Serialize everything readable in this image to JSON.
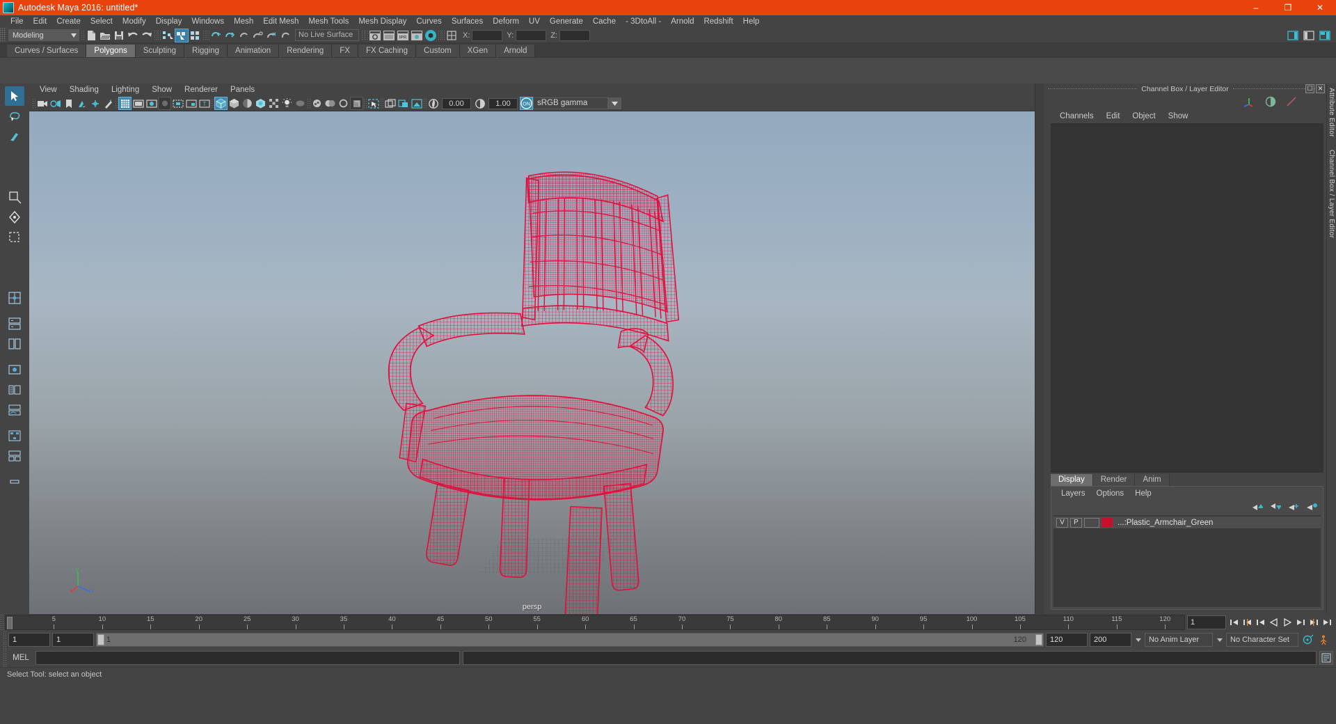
{
  "window": {
    "title": "Autodesk Maya 2016: untitled*",
    "logo_icon": "maya-logo-icon",
    "minimize": "–",
    "maximize": "❐",
    "close": "✕"
  },
  "menubar": {
    "items": [
      "File",
      "Edit",
      "Create",
      "Select",
      "Modify",
      "Display",
      "Windows",
      "Mesh",
      "Edit Mesh",
      "Mesh Tools",
      "Mesh Display",
      "Curves",
      "Surfaces",
      "Deform",
      "UV",
      "Generate",
      "Cache",
      "- 3DtoAll -",
      "Arnold",
      "Redshift",
      "Help"
    ]
  },
  "statusline": {
    "mode": "Modeling",
    "mode_arrow_icon": "chevron-down-icon",
    "live_surface": "No Live Surface",
    "coord_labels": [
      "X:",
      "Y:",
      "Z:"
    ],
    "coord_values": [
      "",
      "",
      ""
    ],
    "icons": [
      "new-scene-icon",
      "open-scene-icon",
      "save-scene-icon",
      "undo-icon",
      "redo-icon",
      "select-hierarchy-icon",
      "select-object-icon",
      "select-component-icon",
      "snap-grid-icon",
      "snap-curve-icon",
      "snap-point-icon",
      "snap-projected-icon",
      "snap-view-plane-icon",
      "render-current-frame-icon",
      "ipr-render-icon",
      "render-settings-icon",
      "hypershade-icon",
      "show-manipulator-icon"
    ],
    "right_icons": [
      "sidebar-attribute-editor-icon",
      "sidebar-tool-settings-icon",
      "sidebar-channel-box-icon"
    ]
  },
  "shelf": {
    "tabs": [
      "Curves / Surfaces",
      "Polygons",
      "Sculpting",
      "Rigging",
      "Animation",
      "Rendering",
      "FX",
      "FX Caching",
      "Custom",
      "XGen",
      "Arnold"
    ],
    "active_tab": "Polygons",
    "icons": [
      "poly-sphere-icon",
      "poly-cube-icon",
      "poly-cylinder-icon",
      "poly-cone-icon",
      "poly-plane-icon",
      "poly-torus-icon",
      "poly-pyramid-icon",
      "poly-prism-icon",
      "SEP",
      "combine-icon",
      "separate-icon",
      "mirror-geometry-icon",
      "smooth-icon",
      "boolean-icon",
      "extrude-icon",
      "create-poly-tool-icon",
      "multi-cut-icon",
      "bevel-icon",
      "bridge-icon",
      "append-polygon-icon",
      "connect-icon",
      "offset-edge-loop-icon",
      "merge-vertex-icon",
      "SEP",
      "uv-planar-icon",
      "uv-cylindrical-icon",
      "uv-spherical-icon",
      "uv-automatic-icon",
      "uv-unfold-icon",
      "uv-editor-icon",
      "uv-cut-icon"
    ],
    "accent_color": "#d88a46",
    "accent_color2": "#58ab86"
  },
  "toolbox": {
    "items": [
      "select-tool-icon",
      "lasso-select-tool-icon",
      "paint-select-tool-icon",
      "move-tool-icon",
      "rotate-tool-icon",
      "scale-tool-icon",
      "soft-select-tool-icon",
      "four-view-layout-icon",
      "two-pane-stacked-icon",
      "two-pane-side-icon",
      "single-perspective-icon",
      "outliner-persp-icon",
      "persp-graph-icon",
      "hypergraph-icon",
      "persp-outliner-icon",
      "last-tool-icon"
    ],
    "selected": "select-tool-icon"
  },
  "viewport": {
    "menu": [
      "View",
      "Shading",
      "Lighting",
      "Show",
      "Renderer",
      "Panels"
    ],
    "camera_label": "persp",
    "exposure": "0.00",
    "gamma": "1.00",
    "color_profile": "sRGB gamma",
    "profile_arrow_icon": "chevron-down-icon",
    "toggle_on_label": "ON",
    "toolbar_icons": [
      "select-camera-icon",
      "camera-attributes-icon",
      "bookmark-icon",
      "image-plane-icon",
      "two-d-pan-zoom-icon",
      "grease-pencil-icon",
      "grid-toggle-icon",
      "film-gate-icon",
      "resolution-gate-icon",
      "gate-mask-icon",
      "field-chart-icon",
      "safe-action-icon",
      "safe-title-icon",
      "wireframe-icon",
      "smooth-shade-all-icon",
      "shaded-flat-icon",
      "shade-textured-icon",
      "use-all-lights-icon",
      "shadows-icon",
      "screen-space-ao-icon",
      "motion-blur-icon",
      "multisample-aa-icon",
      "depth-of-field-icon",
      "isolate-select-icon",
      "xray-icon",
      "xray-joints-icon",
      "xray-active-components-icon",
      "exposure-icon",
      "gamma-icon"
    ],
    "axis_gizmo": {
      "x": "x",
      "y": "y",
      "z": "z"
    },
    "object": "plastic-armchair-wireframe",
    "wire_color": "#e0113f"
  },
  "channel_box": {
    "panel_title": "Channel Box / Layer Editor",
    "float_icon": "undock-icon",
    "close_icon": "close-icon",
    "tool_icons": [
      "manipulator-axis-icon",
      "half-circle-icon",
      "diagonal-line-icon"
    ],
    "menu": [
      "Channels",
      "Edit",
      "Object",
      "Show"
    ]
  },
  "layer_editor": {
    "tabs": [
      "Display",
      "Render",
      "Anim"
    ],
    "active_tab": "Display",
    "menu": [
      "Layers",
      "Options",
      "Help"
    ],
    "button_icons": [
      "move-layer-up-icon",
      "move-layer-down-icon",
      "new-layer-icon",
      "new-layer-from-selected-icon"
    ],
    "layers": [
      {
        "visibility": "V",
        "playback": "P",
        "color": "#c8102e",
        "name": "...:Plastic_Armchair_Green"
      }
    ]
  },
  "attribute_strip": {
    "labels": [
      "Attribute Editor",
      "Channel Box / Layer Editor"
    ]
  },
  "timeline": {
    "ticks": [
      5,
      10,
      15,
      20,
      25,
      30,
      35,
      40,
      45,
      50,
      55,
      60,
      65,
      70,
      75,
      80,
      85,
      90,
      95,
      100,
      105,
      110,
      115,
      120
    ],
    "start": "1",
    "current_frame": "1",
    "playback_icons": [
      "go-to-start-icon",
      "step-back-key-icon",
      "step-back-frame-icon",
      "play-backwards-icon",
      "play-forwards-icon",
      "step-forward-frame-icon",
      "step-forward-key-icon",
      "go-to-end-icon"
    ]
  },
  "range_slider": {
    "anim_start": "1",
    "range_start": "1",
    "range_slider_start": "1",
    "range_slider_end": "120",
    "range_end": "120",
    "anim_end": "200",
    "anim_layer": "No Anim Layer",
    "character_set": "No Character Set",
    "anim_layer_arrow_icon": "chevron-down-icon",
    "char_set_arrow_icon": "chevron-down-icon",
    "auto_key_icon": "auto-keyframe-icon",
    "anim_prefs_icon": "animation-preferences-icon"
  },
  "command_line": {
    "label": "MEL",
    "input_value": "",
    "output_value": "",
    "script_editor_icon": "script-editor-icon"
  },
  "status_bar": {
    "message": "Select Tool: select an object"
  }
}
